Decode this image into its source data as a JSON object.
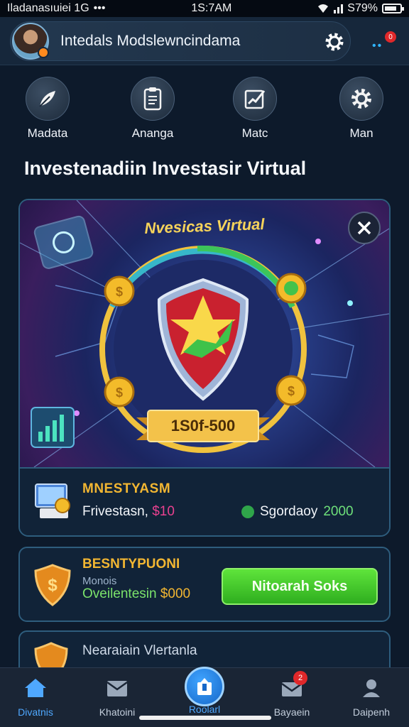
{
  "status_bar": {
    "carrier": "Iladanasıuiei 1G",
    "dots": "•••",
    "time": "1S:7AM",
    "battery_text": "S79%"
  },
  "header": {
    "profile_name": "Intedals Modslewncindama",
    "notification_count": "0"
  },
  "quick_actions": [
    {
      "label": "Madata",
      "icon": "feather-icon"
    },
    {
      "label": "Ananga",
      "icon": "clipboard-icon"
    },
    {
      "label": "Matc",
      "icon": "chart-pen-icon"
    },
    {
      "label": "Man",
      "icon": "gear-icon"
    }
  ],
  "section_title": "Investenadiin Investasir Virtual",
  "hero": {
    "banner_title": "Nvesicas Virtual",
    "ribbon_text": "1S0f-500",
    "info_title": "MNESTYASM",
    "info_left_label": "Frivestasn,",
    "info_left_amount": "$10",
    "info_right_label": "Sgordaoy",
    "info_right_amount": "2000"
  },
  "offer": {
    "title": "BESNTYPUONI",
    "subtitle": "Monois",
    "detail_label": "Oveilentesin",
    "detail_amount": "$000",
    "button_label": "Nitoarah Soks"
  },
  "partial_card": {
    "title": "Nearaiain Vlertanla"
  },
  "bottom_nav": [
    {
      "label": "Divatnis",
      "icon": "home-icon",
      "active": true
    },
    {
      "label": "Khatoini",
      "icon": "mail-icon",
      "active": false
    },
    {
      "label": "Roolarl",
      "icon": "upload-icon",
      "active": true
    },
    {
      "label": "Bayaein",
      "icon": "inbox-icon",
      "active": false,
      "badge": "2"
    },
    {
      "label": "Daipenh",
      "icon": "user-icon",
      "active": false
    }
  ],
  "colors": {
    "accent_blue": "#4fa8ff",
    "gold": "#f2b632",
    "green_button": "#3fc82a",
    "badge_red": "#e0282a"
  }
}
